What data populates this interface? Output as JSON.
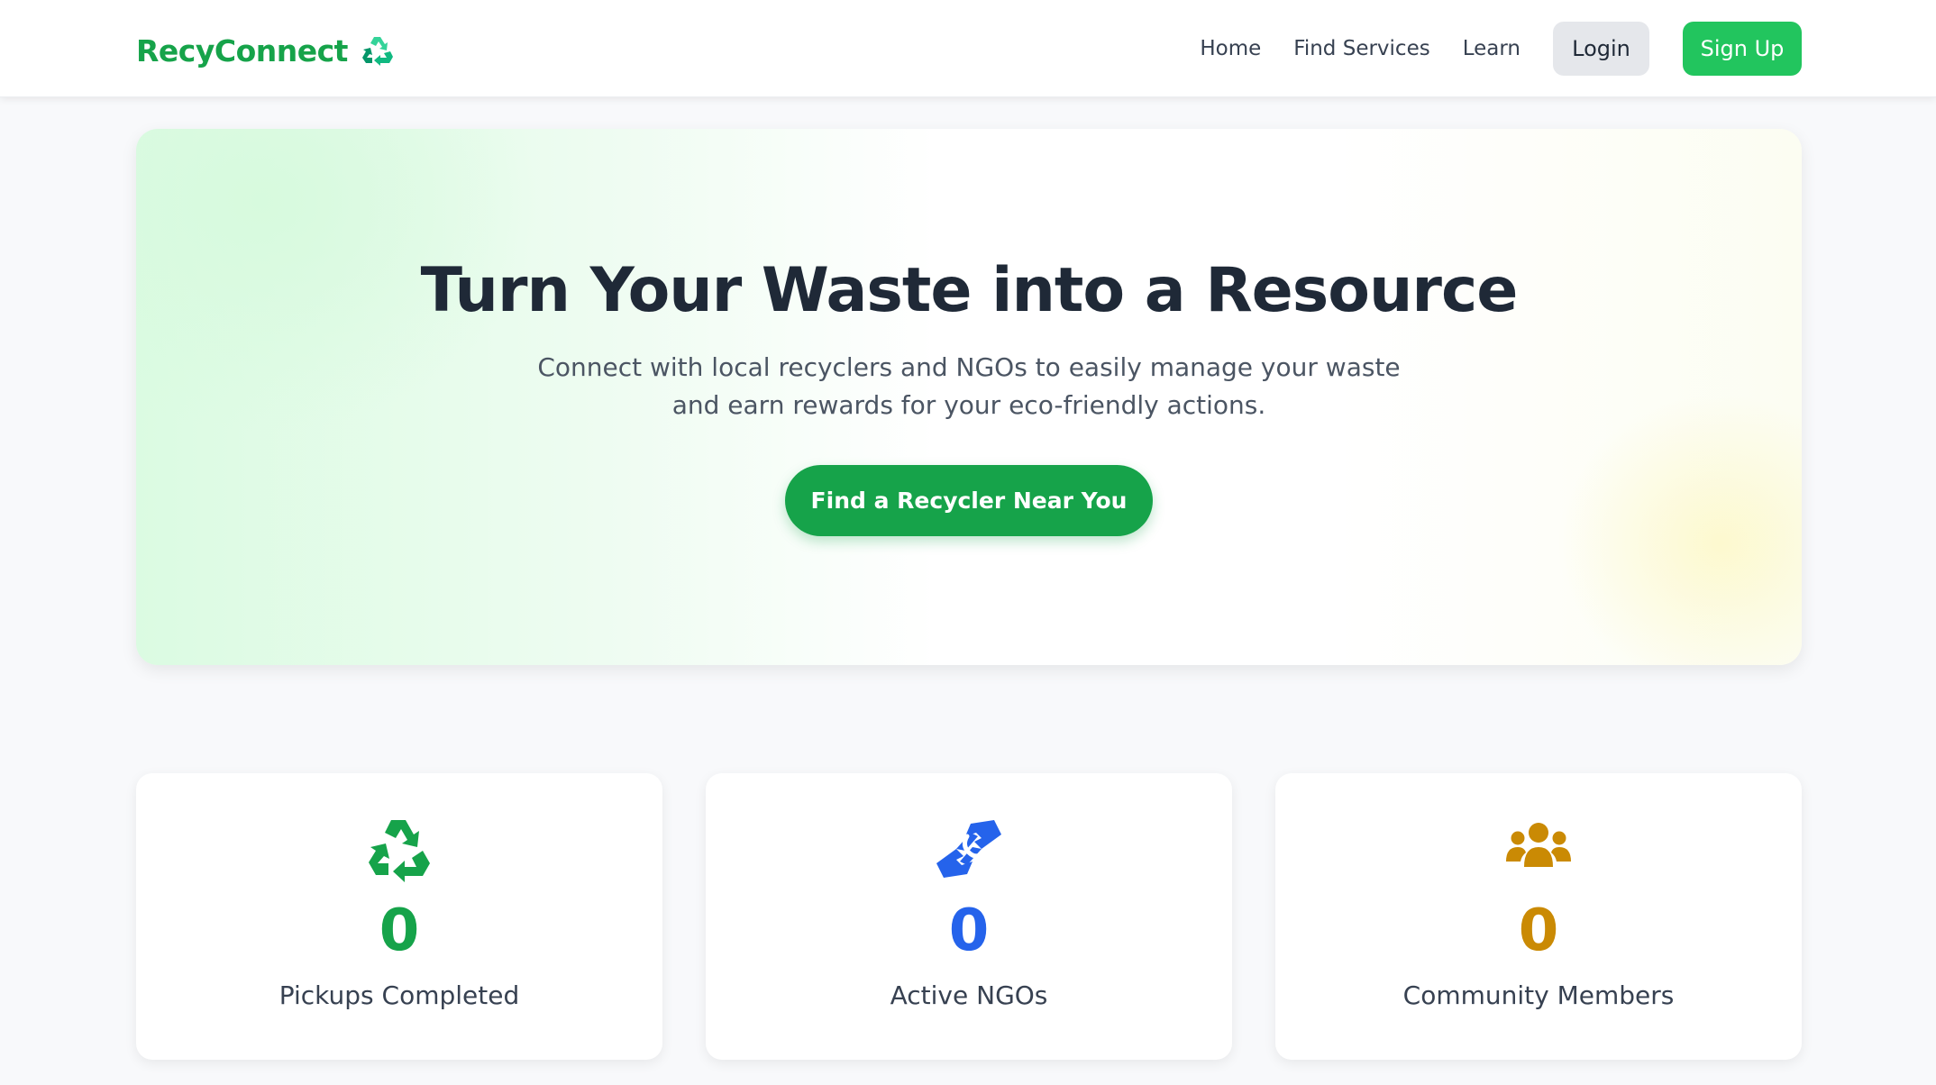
{
  "colors": {
    "brand_green": "#16a34a",
    "signup_green": "#22c55e",
    "login_gray": "#e5e7eb",
    "text_dark": "#1f2937",
    "text_muted": "#4b5563",
    "stat_green": "#16a34a",
    "stat_blue": "#2563eb",
    "stat_amber": "#ca8a04"
  },
  "nav": {
    "brand": "RecyConnect",
    "brand_icon": "recycle-icon",
    "links": [
      "Home",
      "Find Services",
      "Learn"
    ],
    "login_label": "Login",
    "signup_label": "Sign Up"
  },
  "hero": {
    "title": "Turn Your Waste into a Resource",
    "subtitle": "Connect with local recyclers and NGOs to easily manage your waste and earn rewards for your eco-friendly actions.",
    "cta_label": "Find a Recycler Near You"
  },
  "stats": [
    {
      "icon": "recycle-icon",
      "value": "0",
      "label": "Pickups Completed"
    },
    {
      "icon": "handshake-icon",
      "value": "0",
      "label": "Active NGOs"
    },
    {
      "icon": "users-icon",
      "value": "0",
      "label": "Community Members"
    }
  ]
}
